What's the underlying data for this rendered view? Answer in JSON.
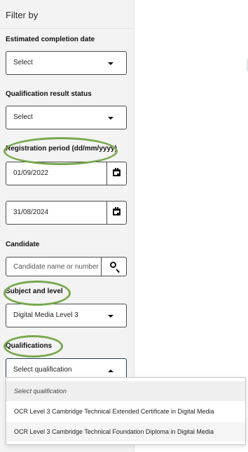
{
  "sidebar": {
    "title": "Filter by",
    "estimated_completion": {
      "label": "Estimated completion date",
      "value": "Select"
    },
    "qualification_result_status": {
      "label": "Qualification result status",
      "value": "Select"
    },
    "registration_period": {
      "label": "Registration period (dd/mm/yyyy)",
      "start": "01/09/2022",
      "end": "31/08/2024"
    },
    "candidate": {
      "label": "Candidate",
      "placeholder": "Candidate name or number"
    },
    "subject_and_level": {
      "label": "Subject and level",
      "value": "Digital Media Level 3"
    },
    "qualifications": {
      "label": "Qualifications",
      "value": "Select qualification",
      "options": [
        "Select qualification",
        "OCR Level 3 Cambridge Technical Extended Certificate in Digital Media",
        "OCR Level 3 Cambridge Technical Foundation Diploma in Digital Media"
      ]
    }
  },
  "icons": {
    "dropdown": "chevron-down-icon",
    "dropdown_open": "chevron-up-icon",
    "calendar": "calendar-icon",
    "search": "search-icon"
  },
  "colors": {
    "sidebar_background": "#f3f3f3",
    "highlight": "#77a84d",
    "control_border": "#4b4b4b",
    "focus_border": "#243d57"
  }
}
